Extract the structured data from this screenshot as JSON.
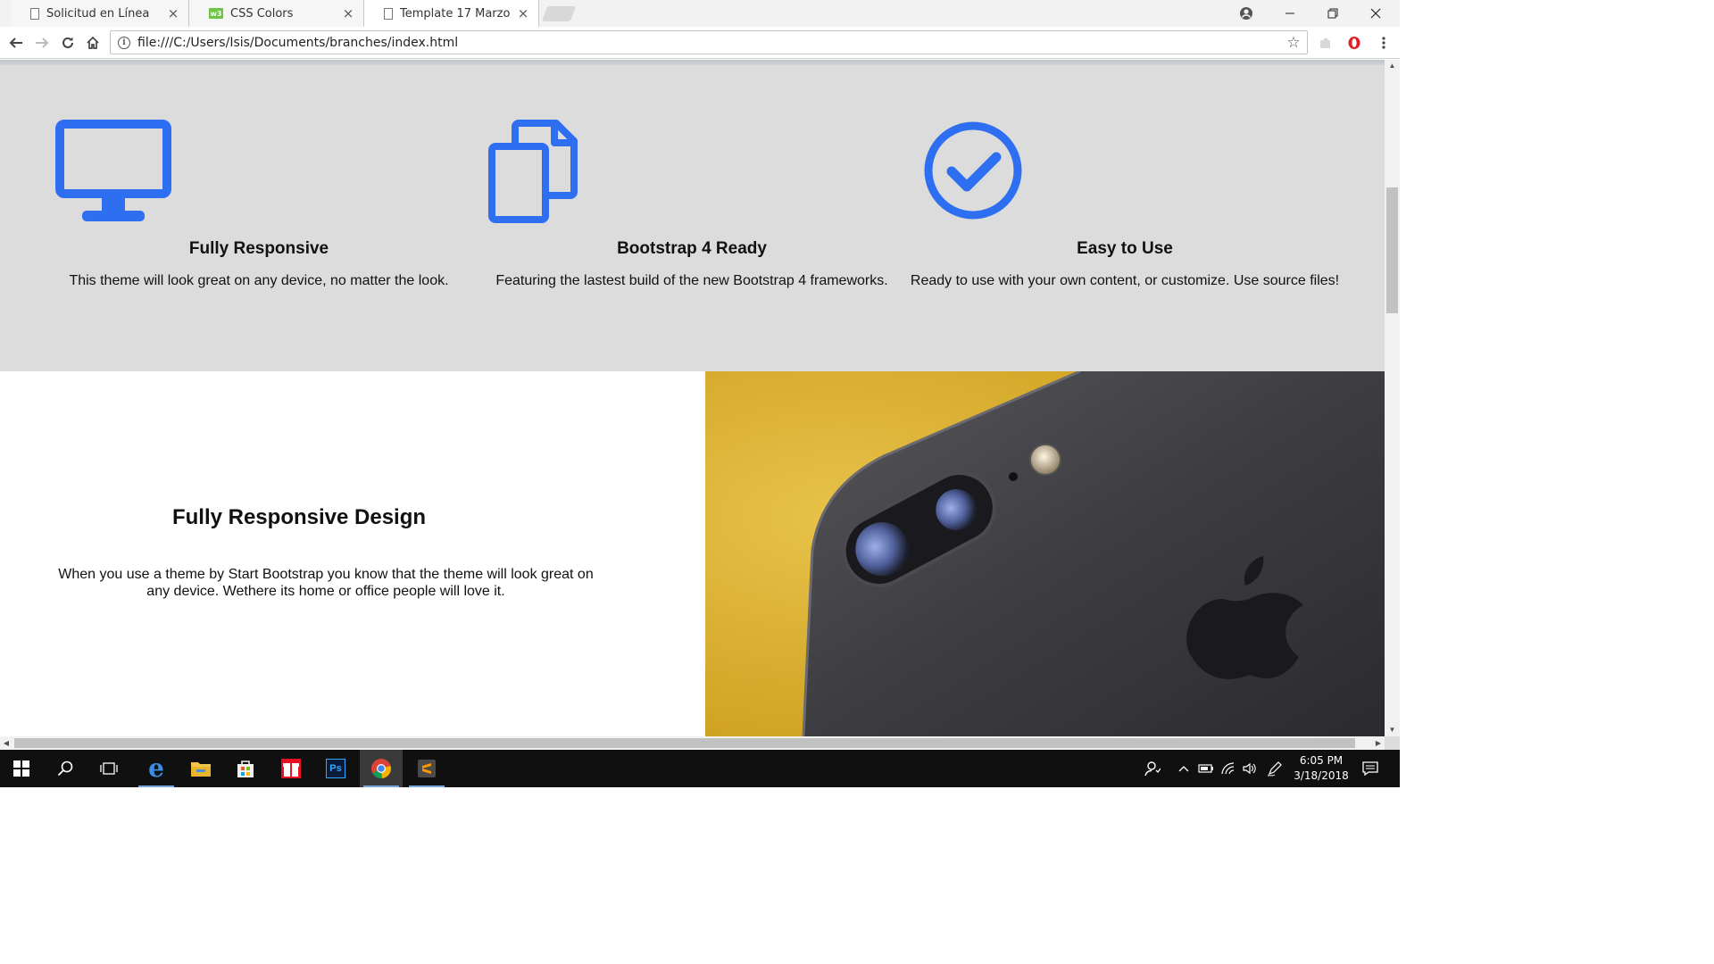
{
  "browser": {
    "tabs": [
      {
        "label": "Solicitud en Línea",
        "icon": "document-icon",
        "active": false
      },
      {
        "label": "CSS Colors",
        "icon": "css-icon",
        "active": false
      },
      {
        "label": "Template 17 Marzo",
        "icon": "document-icon",
        "active": true
      }
    ],
    "tab_close_glyph": "×",
    "url": "file:///C:/Users/Isis/Documents/branches/index.html",
    "info_glyph": "i",
    "window_controls": [
      "profile-icon",
      "minimize-icon",
      "restore-icon",
      "close-icon"
    ]
  },
  "colors": {
    "accent": "#2e6ff2",
    "feature_bg": "#dcdcdc",
    "page_bg": "#ffffff",
    "phone_bg": "#e3b937"
  },
  "page": {
    "features": [
      {
        "icon": "desktop-icon",
        "title": "Fully Responsive",
        "text": "This theme will look great on any device, no matter the look."
      },
      {
        "icon": "copy-icon",
        "title": "Bootstrap 4 Ready",
        "text": "Featuring the lastest build of the new Bootstrap 4 frameworks."
      },
      {
        "icon": "check-circle-icon",
        "title": "Easy to Use",
        "text": "Ready to use with your own content, or customize. Use source files!"
      }
    ],
    "showcase": {
      "title": "Fully Responsive Design",
      "text": "When you use a theme by Start Bootstrap you know that the theme will look great on any device. Wethere its home or office people will love it.",
      "image": "phone-camera-photo"
    }
  },
  "taskbar": {
    "apps": [
      "windows-start-icon",
      "search-icon",
      "task-view-icon",
      "edge-icon",
      "file-explorer-icon",
      "store-icon",
      "gift-app-icon",
      "photoshop-icon",
      "chrome-icon",
      "sublime-icon"
    ],
    "photoshop_label": "Ps",
    "time": "6:05 PM",
    "date": "3/18/2018"
  }
}
